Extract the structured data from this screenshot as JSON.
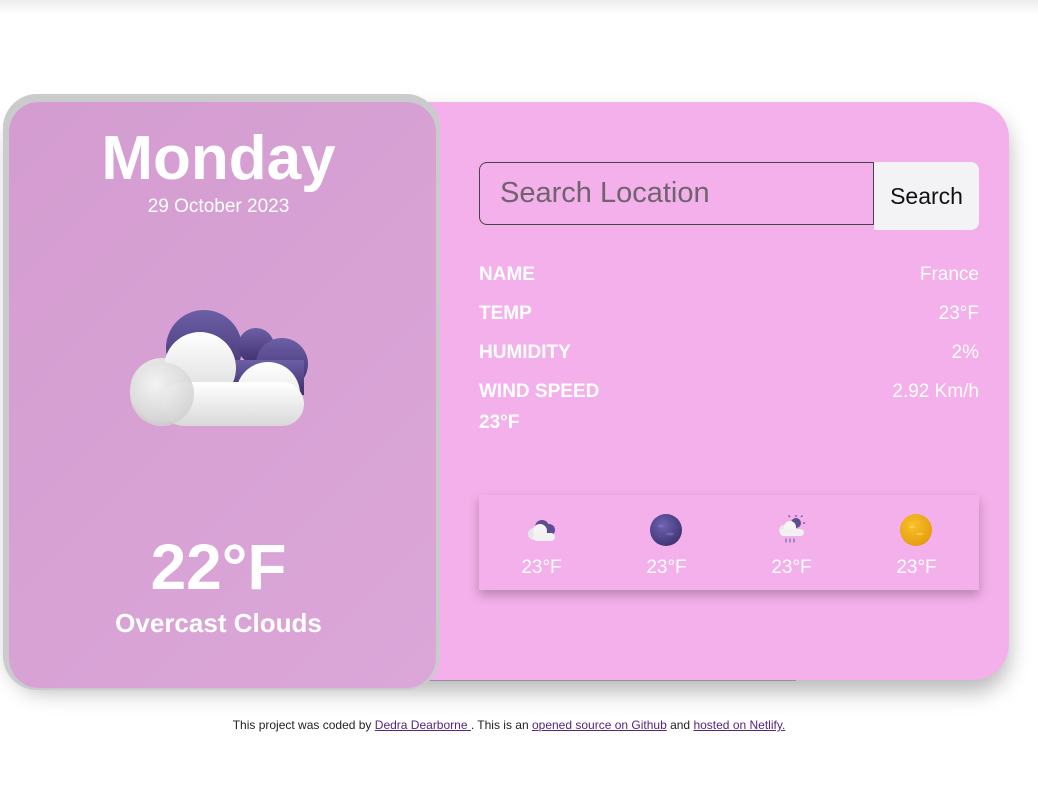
{
  "today": {
    "day": "Monday",
    "date": "29 October 2023",
    "icon": "overcast-clouds-icon",
    "temperature": "22°F",
    "description": "Overcast Clouds"
  },
  "search": {
    "placeholder": "Search Location",
    "value": "",
    "button_label": "Search"
  },
  "details": [
    {
      "label": "NAME",
      "value": "France"
    },
    {
      "label": "TEMP",
      "value": "23°F"
    },
    {
      "label": "HUMIDITY",
      "value": "2%"
    },
    {
      "label": "WIND SPEED",
      "value": "2.92 Km/h"
    }
  ],
  "extra_temp": "23°F",
  "forecast": [
    {
      "icon": "cloudy-night-icon",
      "temp": "23°F"
    },
    {
      "icon": "moon-icon",
      "temp": "23°F"
    },
    {
      "icon": "rain-sun-icon",
      "temp": "23°F"
    },
    {
      "icon": "sun-icon",
      "temp": "23°F"
    }
  ],
  "footer": {
    "text1": "This project was coded by ",
    "author_link": "Dedra Dearborne ",
    "text2": ". This is an ",
    "source_link": "opened source on Github",
    "text3": " and ",
    "host_link": "hosted on Netlify."
  },
  "colors": {
    "card_background": "#f4b0ea",
    "left_panel": "#d69fd2",
    "link": "#55257f"
  }
}
